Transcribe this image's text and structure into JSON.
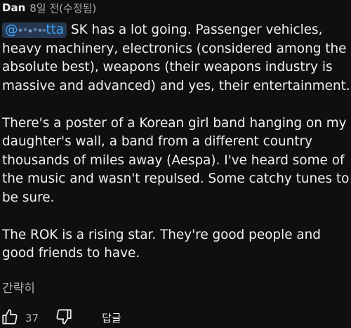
{
  "comment": {
    "author": "Dan",
    "timestamp": "8일 전(수정됨)",
    "mention_prefix": "@",
    "mention_suffix": "tta",
    "paragraph1_rest": " SK has a lot going.  Passenger vehicles, heavy machinery, electronics (considered among the absolute best), weapons (their weapons industry is massive and advanced) and yes, their entertainment.",
    "paragraph2": "There's a poster of a Korean girl band hanging on my daughter's wall, a band from a different country thousands of miles away (Aespa).  I've heard some of the music and wasn't repulsed.  Some catchy tunes to be sure.",
    "paragraph3": "The ROK is a rising star.  They're good people and good friends to have.",
    "show_less_label": "간략히"
  },
  "actions": {
    "like_icon": "thumbs-up-icon",
    "like_count": "37",
    "dislike_icon": "thumbs-down-icon",
    "reply_label": "답글"
  },
  "colors": {
    "background": "#0f0f0f",
    "text_primary": "#f1f1f1",
    "text_secondary": "#aaaaaa",
    "mention_bg": "#263850",
    "mention_text": "#3ea6ff"
  }
}
